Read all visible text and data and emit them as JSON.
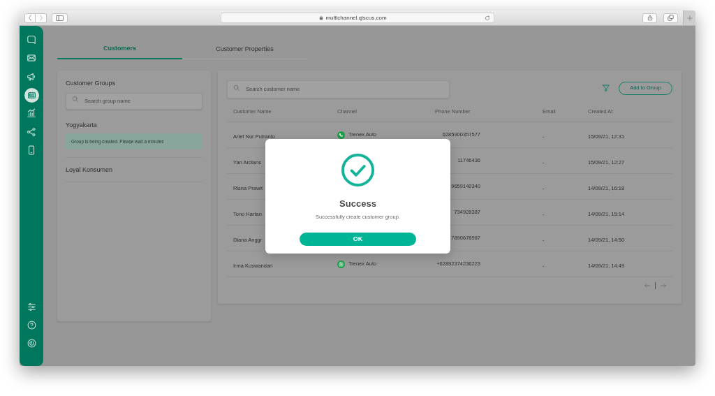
{
  "browser": {
    "url": "multichannel.qiscus.com"
  },
  "sidebar": {
    "items": [
      {
        "kind": "chat",
        "selected": false
      },
      {
        "kind": "mail",
        "selected": false
      },
      {
        "kind": "broadcast",
        "selected": false
      },
      {
        "kind": "contacts",
        "selected": true
      },
      {
        "kind": "analytics",
        "selected": false
      },
      {
        "kind": "integrations",
        "selected": false
      },
      {
        "kind": "mobile",
        "selected": false
      }
    ],
    "bottom_items": [
      {
        "kind": "settings"
      },
      {
        "kind": "help"
      },
      {
        "kind": "logout"
      }
    ]
  },
  "tabs": [
    {
      "label": "Customers",
      "selected": true
    },
    {
      "label": "Customer Properties",
      "selected": false
    }
  ],
  "groups_panel": {
    "title": "Customer Groups",
    "search": {
      "placeholder": "Search group name"
    },
    "groups": [
      {
        "name": "Yogyakarta",
        "notice": "Group is being created. Please wait a minutes"
      },
      {
        "name": "Loyal Konsumen"
      }
    ]
  },
  "customers_panel": {
    "search": {
      "placeholder": "Search customer name"
    },
    "add_button": "Add to Group",
    "table": {
      "columns": [
        "Customer Name",
        "Channel",
        "Phone Number",
        "Email",
        "Created At"
      ],
      "rows": [
        {
          "name": "Arief Nur Putranto",
          "channel": {
            "kind": "chat",
            "name": "Trenex Auto"
          },
          "phone": "6285900357577",
          "email": "-",
          "created_at": "15/09/21, 12:31"
        },
        {
          "name": "Yan Ardians",
          "phone": "11746436",
          "email": "-",
          "created_at": "15/09/21, 12:27"
        },
        {
          "name": "Risna Prawit",
          "phone": "9659140340",
          "email": "-",
          "created_at": "14/09/21, 16:18"
        },
        {
          "name": "Tono Hartan",
          "phone": "734928387",
          "email": "-",
          "created_at": "14/09/21, 15:14"
        },
        {
          "name": "Diana Anggr",
          "phone": "7890678987",
          "email": "-",
          "created_at": "14/09/21, 14:50"
        },
        {
          "name": "Irma Kuswandari",
          "channel": {
            "kind": "widget",
            "name": "Trenex Auto"
          },
          "phone": "+62892374236223",
          "email": "-",
          "created_at": "14/09/21, 14:49"
        }
      ]
    }
  },
  "dialog": {
    "title": "Success",
    "message": "Successfully create customer group.",
    "button": "OK"
  }
}
